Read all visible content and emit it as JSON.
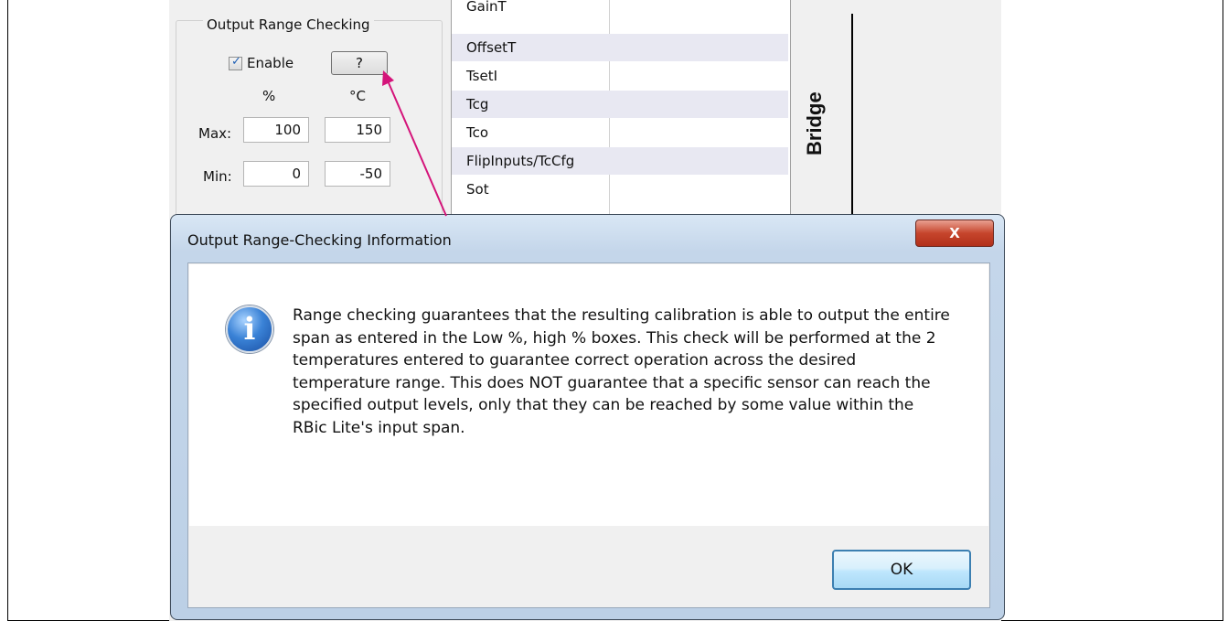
{
  "range_panel": {
    "title": "Output Range Checking",
    "enable_label": "Enable",
    "enable_checked": true,
    "help_label": "?",
    "col_percent": "%",
    "col_celsius": "°C",
    "max_label": "Max:",
    "min_label": "Min:",
    "max_percent": "100",
    "max_celsius": "150",
    "min_percent": "0",
    "min_celsius": "-50"
  },
  "param_list": {
    "items": [
      "GainT",
      "OffsetT",
      "TsetI",
      "Tcg",
      "Tco",
      "FlipInputs/TcCfg",
      "Sot"
    ]
  },
  "side_label": "Bridge",
  "dialog": {
    "title": "Output Range-Checking Information",
    "close_label": "X",
    "message": "Range checking guarantees that the resulting calibration is able to output the entire span as entered in the Low %, high % boxes. This check will be performed at the 2 temperatures entered to guarantee correct operation across the desired temperature range. This does NOT guarantee that a specific sensor can reach the specified output levels, only that they can be reached by some value within the RBic Lite's input span.",
    "ok_label": "OK"
  },
  "colors": {
    "arrow": "#d4147a",
    "close_button": "#c6452c",
    "dialog_frame": "#c4d6ea"
  },
  "icons": {
    "info": "information-icon",
    "check": "checkmark-icon"
  }
}
